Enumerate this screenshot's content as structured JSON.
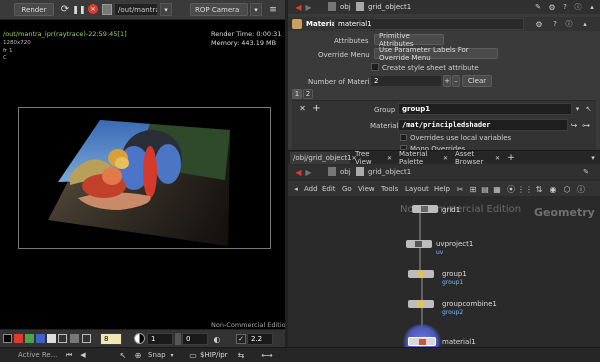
{
  "colors": {
    "accent_red": "#e03a2f",
    "overlay_green": "#9fcf6a",
    "node_label_blue": "#7fb7ff",
    "panel_bg": "#3a3a3a",
    "dark_bg": "#2b2b2b",
    "toolbar_bg": "#333333"
  },
  "viewer": {
    "render_button": "Render",
    "path": "/out/mantra_ipr",
    "camera": "ROP Camera",
    "overlay": {
      "title": "/out/mantra_ipr(raytrace)-22:59:45[1]",
      "resolution": "1280x720",
      "fr": "fr 1",
      "c": "C",
      "render_time": "Render Time: 0:00:31",
      "memory": "Memory:    443.19 MB",
      "watermark": "Non-Commercial Edition"
    },
    "bottom": {
      "frame_value": "8",
      "field2": "1",
      "field3": "0",
      "field4": "2.2"
    }
  },
  "parm_pane": {
    "path_prefix": "obj",
    "path_node": "grid_object1",
    "node_type": "Material",
    "node_name": "material1",
    "attributes_label": "Attributes",
    "attributes_value": "Primitive Attributes",
    "override_menu_label": "Override Menu",
    "override_menu_value": "Use Parameter Labels For Override Menu",
    "create_style_sheet": "Create style sheet attribute",
    "num_materials_label": "Number of Materials",
    "num_materials_value": "2",
    "plus": "+",
    "minus": "–",
    "clear": "Clear",
    "tab1": "1",
    "tab2": "2",
    "group_label": "Group",
    "group_value": "group1",
    "material_label": "Material",
    "material_value": "/mat/principledshader",
    "overrides_local": "Overrides use local variables",
    "more_overrides": "Mono Overrides"
  },
  "network": {
    "tabs": [
      "/obj/grid_object1",
      "Tree View",
      "Material Palette",
      "Asset Browser"
    ],
    "path_prefix": "obj",
    "path_node": "grid_object1",
    "menu": [
      "Add",
      "Edit",
      "Go",
      "View",
      "Tools",
      "Layout",
      "Help"
    ],
    "watermark": "Non-Commercial Edition",
    "context_label": "Geometry",
    "nodes": [
      {
        "name": "grid1",
        "sub": ""
      },
      {
        "name": "uvproject1",
        "sub": "uv"
      },
      {
        "name": "group1",
        "sub": "group1"
      },
      {
        "name": "groupcombine1",
        "sub": "group2"
      },
      {
        "name": "material1",
        "sub": ""
      }
    ]
  },
  "status": {
    "active": "Active Re...",
    "snap": "Snap",
    "ship": "$HIP/ipr"
  }
}
